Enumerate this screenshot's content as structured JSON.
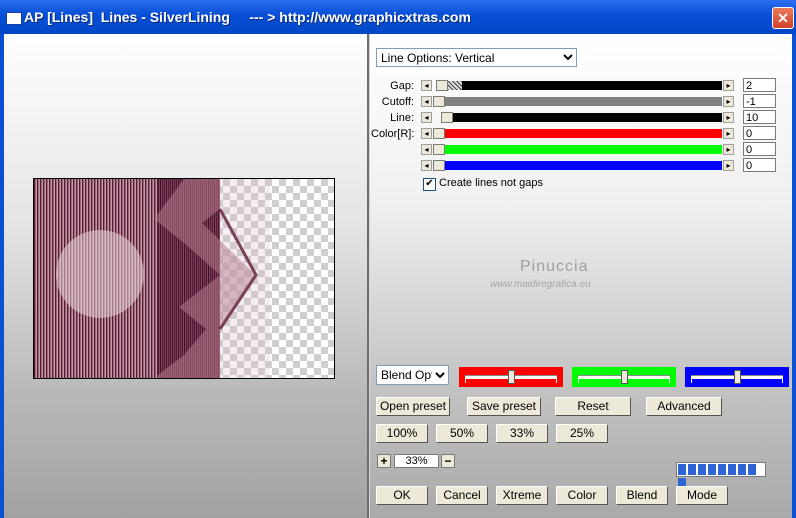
{
  "window": {
    "title": "AP [Lines]  Lines - SilverLining     --- > http://www.graphicxtras.com",
    "close_glyph": "✕"
  },
  "options": {
    "line_options": "Line Options: Vertical",
    "blend_options": "Blend Options"
  },
  "sliders": [
    {
      "label": "Gap:",
      "value": "2",
      "color": "#000000",
      "fraction": 0.01
    },
    {
      "label": "Cutoff:",
      "value": "-1",
      "color": "#808080",
      "fraction": 0.0
    },
    {
      "label": "Line:",
      "value": "10",
      "color": "#000000",
      "fraction": 0.03
    },
    {
      "label": "Color[R]:",
      "value": "0",
      "color": "#ff0000",
      "fraction": 0.0
    },
    {
      "label": "",
      "value": "0",
      "color": "#00ff00",
      "fraction": 0.0
    },
    {
      "label": "",
      "value": "0",
      "color": "#0000ff",
      "fraction": 0.0
    }
  ],
  "checkbox": {
    "label": "Create lines not gaps",
    "checked": true,
    "glyph": "✔"
  },
  "watermark": {
    "name": "Pinuccia",
    "site": "www.maidiregrafica.eu"
  },
  "color_sliders": [
    {
      "color": "#ff0000",
      "fraction": 0.5
    },
    {
      "color": "#00ff00",
      "fraction": 0.5
    },
    {
      "color": "#0000ff",
      "fraction": 0.5
    }
  ],
  "buttons": {
    "open_preset": "Open preset",
    "save_preset": "Save preset",
    "reset": "Reset",
    "advanced": "Advanced",
    "z100": "100%",
    "z50": "50%",
    "z33": "33%",
    "z25": "25%",
    "ok": "OK",
    "cancel": "Cancel",
    "xtreme": "Xtreme",
    "color": "Color",
    "blend": "Blend",
    "mode": "Mode"
  },
  "zoom": {
    "plus": "+",
    "minus": "−",
    "value": "33%"
  },
  "progress": {
    "segments": 9,
    "filled": 9
  },
  "colors": {
    "titlebar": "#0a50d8",
    "close": "#d3412a",
    "preview_lines": "#5a1a34",
    "preview_fill": "#b47a8e"
  }
}
